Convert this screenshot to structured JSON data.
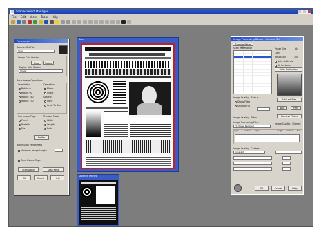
{
  "window": {
    "title": "Scan & Select Manager"
  },
  "menu": [
    "File",
    "Edit",
    "View",
    "Tools",
    "Help"
  ],
  "left_dialog": {
    "title": "Parameters",
    "scanner_label": "Scanner Set File",
    "scanner_value": "Scan",
    "image_label": "Image Cold Station",
    "new_btn": "New",
    "delete_btn": "Delete",
    "display_label": "Display Cold Station",
    "display_value": "Image",
    "basic_label": "Basic Image Operations",
    "rotation_label": "Orientation",
    "rotation_opts": [
      "Rotate 0",
      "Rotate 90",
      "Rotate 180",
      "Rotate 270"
    ],
    "operation_label": "Operation",
    "operation_opts": [
      "Mirror",
      "Invert"
    ],
    "scaling_label": "Scaling",
    "scaling_opts": [
      "None",
      "Scale To Size"
    ],
    "sub_label": "Sub Image Page",
    "sub_opts": [
      "Panel",
      "Portable",
      "File"
    ],
    "transfer_label": "Transfer Mode",
    "transfer_opts": [
      "Width",
      "Length",
      "Both"
    ],
    "profile_btn": "Profile",
    "batch_label": "Batch Scan Parameters",
    "batch_check": "Minimum Image Length",
    "zone_check": "Zone Delete Pages",
    "scan_again": "Scan Again",
    "scan_next": "Scan Next",
    "ok": "OK",
    "cancel": "Cancel",
    "help": "Help"
  },
  "main_doc": {
    "title": "Scan"
  },
  "thumb_doc": {
    "title": "Scanned Preview"
  },
  "right_panel": {
    "title": "Image Processing Dialog - Scanner Set",
    "tab": "Scanner Setup File",
    "scan_label": "Scan Information",
    "size_label": "Paper Size",
    "size_value": "A4",
    "light_label": "Light",
    "dpi_label": "Resolution",
    "dpi_value": "300",
    "auto_check": "Auto Calibrate",
    "all_check": "All Sections",
    "color_btn": "Color Calibration",
    "image_quality_label": "Image Quality - Scan ▶",
    "sharp_opt": "Sharp Filter",
    "smooth_opt": "Smooth Filt",
    "apply_btn": "Set Last Files",
    "next_btn": "Next",
    "prev_btn": "Prev",
    "remove_btn": "Remove Filters",
    "quality_filter_label": "Image Quality - Filters",
    "processing_label": "Image Processing Filter",
    "processing_value": "Tilt Noise Removal",
    "despeckle_label": "Image Quality - Filtered",
    "header_row": [
      "Light",
      "Contrast",
      "Edge",
      "Length",
      "Contrast",
      "Size"
    ],
    "final_label": "Image Quality - Contrast",
    "final_value": "Constant",
    "ok": "OK",
    "cancel": "Cancel",
    "help": "Help"
  }
}
